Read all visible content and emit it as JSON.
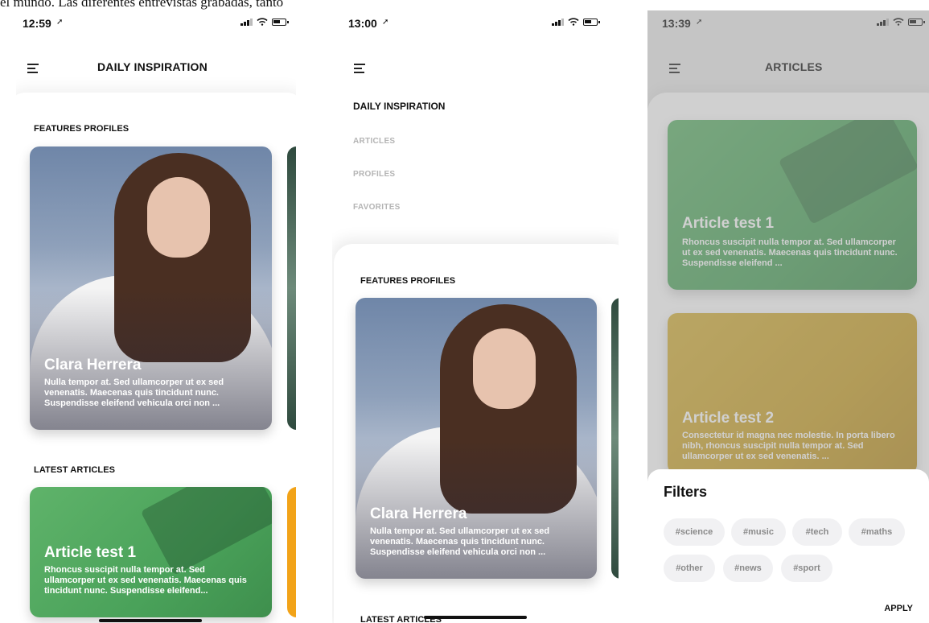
{
  "caption": "el mundo. Las diferentes entrevistas grabadas, tanto",
  "screen1": {
    "time": "12:59",
    "title": "DAILY INSPIRATION",
    "section_profiles": "FEATURES PROFILES",
    "profile": {
      "name": "Clara Herrera",
      "desc": "Nulla tempor at. Sed ullamcorper ut ex sed venenatis. Maecenas quis tincidunt nunc. Suspendisse eleifend vehicula orci non ..."
    },
    "section_articles": "LATEST ARTICLES",
    "article": {
      "title": "Article test 1",
      "desc": "Rhoncus suscipit nulla tempor at. Sed ullamcorper ut ex sed venenatis. Maecenas quis tincidunt nunc. Suspendisse eleifend..."
    }
  },
  "screen2": {
    "time": "13:00",
    "menu": {
      "active": "DAILY INSPIRATION",
      "items": [
        "ARTICLES",
        "PROFILES",
        "FAVORITES"
      ]
    },
    "section_profiles": "FEATURES PROFILES",
    "profile": {
      "name": "Clara Herrera",
      "desc": "Nulla tempor at. Sed ullamcorper ut ex sed venenatis. Maecenas quis tincidunt nunc. Suspendisse eleifend vehicula orci non ..."
    },
    "section_articles": "LATEST ARTICLES"
  },
  "screen3": {
    "time": "13:39",
    "title": "ARTICLES",
    "articles": [
      {
        "title": "Article test 1",
        "desc": "Rhoncus suscipit nulla tempor at. Sed ullamcorper ut ex sed venenatis. Maecenas quis tincidunt nunc. Suspendisse eleifend ..."
      },
      {
        "title": "Article test 2",
        "desc": "Consectetur id magna nec molestie. In porta libero nibh, rhoncus suscipit nulla tempor at. Sed ullamcorper ut ex sed venenatis. ..."
      }
    ],
    "filters": {
      "title": "Filters",
      "tags": [
        "#science",
        "#music",
        "#tech",
        "#maths",
        "#other",
        "#news",
        "#sport"
      ],
      "apply": "APPLY"
    }
  },
  "icons": {
    "menu": "hamburger-menu-icon",
    "signal": "signal-icon",
    "wifi": "wifi-icon",
    "battery": "battery-icon",
    "location": "location-arrow-icon"
  },
  "colors": {
    "article_green": "#4aa25a",
    "article_yellow": "#c9a027",
    "chip_bg": "#f1f1f3",
    "menu_inactive": "#b4b4b4"
  }
}
